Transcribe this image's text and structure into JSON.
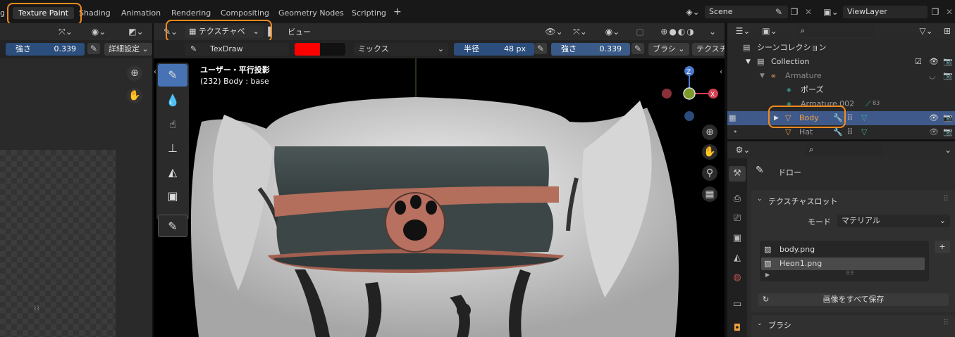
{
  "workspaces": [
    "g",
    "Texture Paint",
    "Shading",
    "Animation",
    "Rendering",
    "Compositing",
    "Geometry Nodes",
    "Scripting",
    "+"
  ],
  "scene": {
    "label": "Scene",
    "viewlayer": "ViewLayer"
  },
  "image_editor": {
    "strength_label": "強さ",
    "strength_value": "0.339",
    "advanced_label": "詳細設定",
    "cursor_glyph": "⌇⌇"
  },
  "viewport_header": {
    "mode_label": "テクスチャペ",
    "view_menu": "ビュー",
    "brush_name": "TexDraw",
    "blend_mode": "ミックス",
    "radius_label": "半径",
    "radius_value": "48 px",
    "strength_label": "強さ",
    "strength_value": "0.339",
    "brush_menu": "ブラシ",
    "texture_menu": "テクスチ"
  },
  "viewport": {
    "overlay_line1": "ユーザー・平行投影",
    "overlay_line2": "(232) Body : base",
    "gizmo_x": "X",
    "gizmo_y": "Y",
    "gizmo_z": "Z"
  },
  "outliner": {
    "root": "シーンコレクション",
    "collection": "Collection",
    "armature": "Armature",
    "pose": "ポーズ",
    "armature_data": "Armature.002",
    "armature_count": "83",
    "body": "Body",
    "hat": "Hat"
  },
  "properties": {
    "tool_title": "ドロー",
    "texture_slots_title": "テクスチャスロット",
    "mode_label": "モード",
    "mode_value": "マテリアル",
    "slots": [
      "body.png",
      "Heon1.png"
    ],
    "save_all": "画像をすべて保存",
    "brush_section": "ブラシ"
  },
  "colors": {
    "accent": "#f28a1e",
    "selection": "#3f5a8a",
    "paint_color": "#ff0000",
    "hat_band": "#b87060",
    "hat_body": "#3e4848"
  }
}
